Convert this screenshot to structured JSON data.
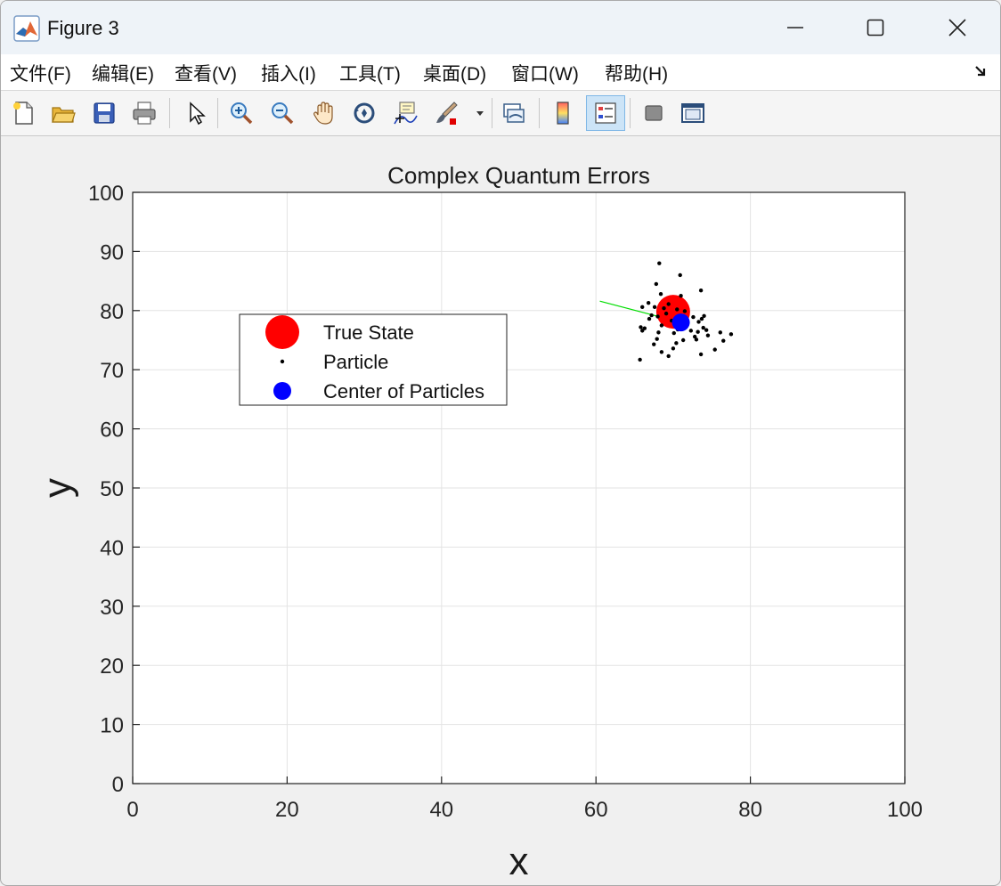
{
  "window": {
    "title": "Figure 3"
  },
  "menu": {
    "items": [
      "文件(F)",
      "编辑(E)",
      "查看(V)",
      "插入(I)",
      "工具(T)",
      "桌面(D)",
      "窗口(W)",
      "帮助(H)"
    ]
  },
  "toolbar": {
    "buttons": [
      {
        "name": "new-figure",
        "icon": "new-file-icon"
      },
      {
        "name": "open-file",
        "icon": "folder-open-icon"
      },
      {
        "name": "save-figure",
        "icon": "save-disk-icon"
      },
      {
        "name": "print-figure",
        "icon": "printer-icon"
      },
      {
        "name": "edit-plot",
        "icon": "pointer-arrow-icon"
      },
      {
        "name": "zoom-in",
        "icon": "zoom-in-icon"
      },
      {
        "name": "zoom-out",
        "icon": "zoom-out-icon"
      },
      {
        "name": "pan",
        "icon": "hand-pan-icon"
      },
      {
        "name": "rotate-3d",
        "icon": "rotate-3d-icon"
      },
      {
        "name": "data-cursor",
        "icon": "data-cursor-icon"
      },
      {
        "name": "brush",
        "icon": "brush-icon"
      },
      {
        "name": "link-plot",
        "icon": "link-plot-icon"
      },
      {
        "name": "insert-colorbar",
        "icon": "colorbar-icon"
      },
      {
        "name": "insert-legend",
        "icon": "legend-icon",
        "active": true
      },
      {
        "name": "hide-plot-tools",
        "icon": "hide-tools-icon"
      },
      {
        "name": "show-plot-tools",
        "icon": "show-tools-icon"
      }
    ]
  },
  "colors": {
    "true_state": "#ff0000",
    "particle": "#000000",
    "center": "#0000ff",
    "heading": "#00dd00"
  },
  "chart_data": {
    "type": "scatter",
    "title": "Complex Quantum Errors",
    "xlabel": "x",
    "ylabel": "y",
    "xlim": [
      0,
      100
    ],
    "ylim": [
      0,
      100
    ],
    "xticks": [
      0,
      20,
      40,
      60,
      80,
      100
    ],
    "yticks": [
      0,
      10,
      20,
      30,
      40,
      50,
      60,
      70,
      80,
      90,
      100
    ],
    "grid": true,
    "legend_position": "upper-left",
    "series": [
      {
        "name": "True State",
        "marker": "large-circle",
        "points": [
          [
            70.0,
            79.8
          ]
        ]
      },
      {
        "name": "Particle",
        "marker": "dot",
        "points": [
          [
            68.2,
            88.0
          ],
          [
            70.9,
            86.0
          ],
          [
            67.8,
            84.5
          ],
          [
            73.6,
            83.4
          ],
          [
            68.4,
            82.8
          ],
          [
            71.0,
            82.5
          ],
          [
            66.8,
            81.3
          ],
          [
            69.4,
            81.1
          ],
          [
            67.6,
            80.6
          ],
          [
            66.0,
            80.6
          ],
          [
            68.8,
            80.4
          ],
          [
            70.5,
            80.2
          ],
          [
            71.5,
            79.9
          ],
          [
            69.1,
            79.5
          ],
          [
            67.2,
            79.2
          ],
          [
            68.0,
            79.0
          ],
          [
            72.6,
            78.9
          ],
          [
            74.0,
            79.1
          ],
          [
            73.7,
            78.6
          ],
          [
            66.9,
            78.6
          ],
          [
            69.8,
            78.3
          ],
          [
            71.9,
            78.0
          ],
          [
            73.3,
            78.1
          ],
          [
            68.5,
            77.5
          ],
          [
            65.8,
            77.2
          ],
          [
            66.3,
            77.0
          ],
          [
            70.6,
            76.8
          ],
          [
            72.3,
            76.6
          ],
          [
            73.9,
            77.1
          ],
          [
            74.3,
            76.7
          ],
          [
            66.0,
            76.6
          ],
          [
            68.1,
            76.3
          ],
          [
            70.1,
            76.2
          ],
          [
            73.2,
            76.4
          ],
          [
            76.1,
            76.3
          ],
          [
            77.5,
            76.0
          ],
          [
            72.8,
            75.6
          ],
          [
            74.5,
            75.8
          ],
          [
            67.9,
            75.2
          ],
          [
            71.3,
            75.0
          ],
          [
            73.0,
            75.1
          ],
          [
            76.5,
            74.9
          ],
          [
            70.4,
            74.5
          ],
          [
            67.5,
            74.3
          ],
          [
            70.0,
            73.6
          ],
          [
            75.4,
            73.4
          ],
          [
            68.5,
            73.0
          ],
          [
            73.6,
            72.6
          ],
          [
            69.4,
            72.3
          ],
          [
            65.7,
            71.7
          ]
        ]
      },
      {
        "name": "Center of Particles",
        "marker": "medium-circle",
        "points": [
          [
            71.0,
            78.0
          ]
        ]
      }
    ],
    "annotations": [
      {
        "type": "line",
        "color": "green",
        "from": [
          60.5,
          81.6
        ],
        "to": [
          71.0,
          78.0
        ]
      }
    ]
  }
}
